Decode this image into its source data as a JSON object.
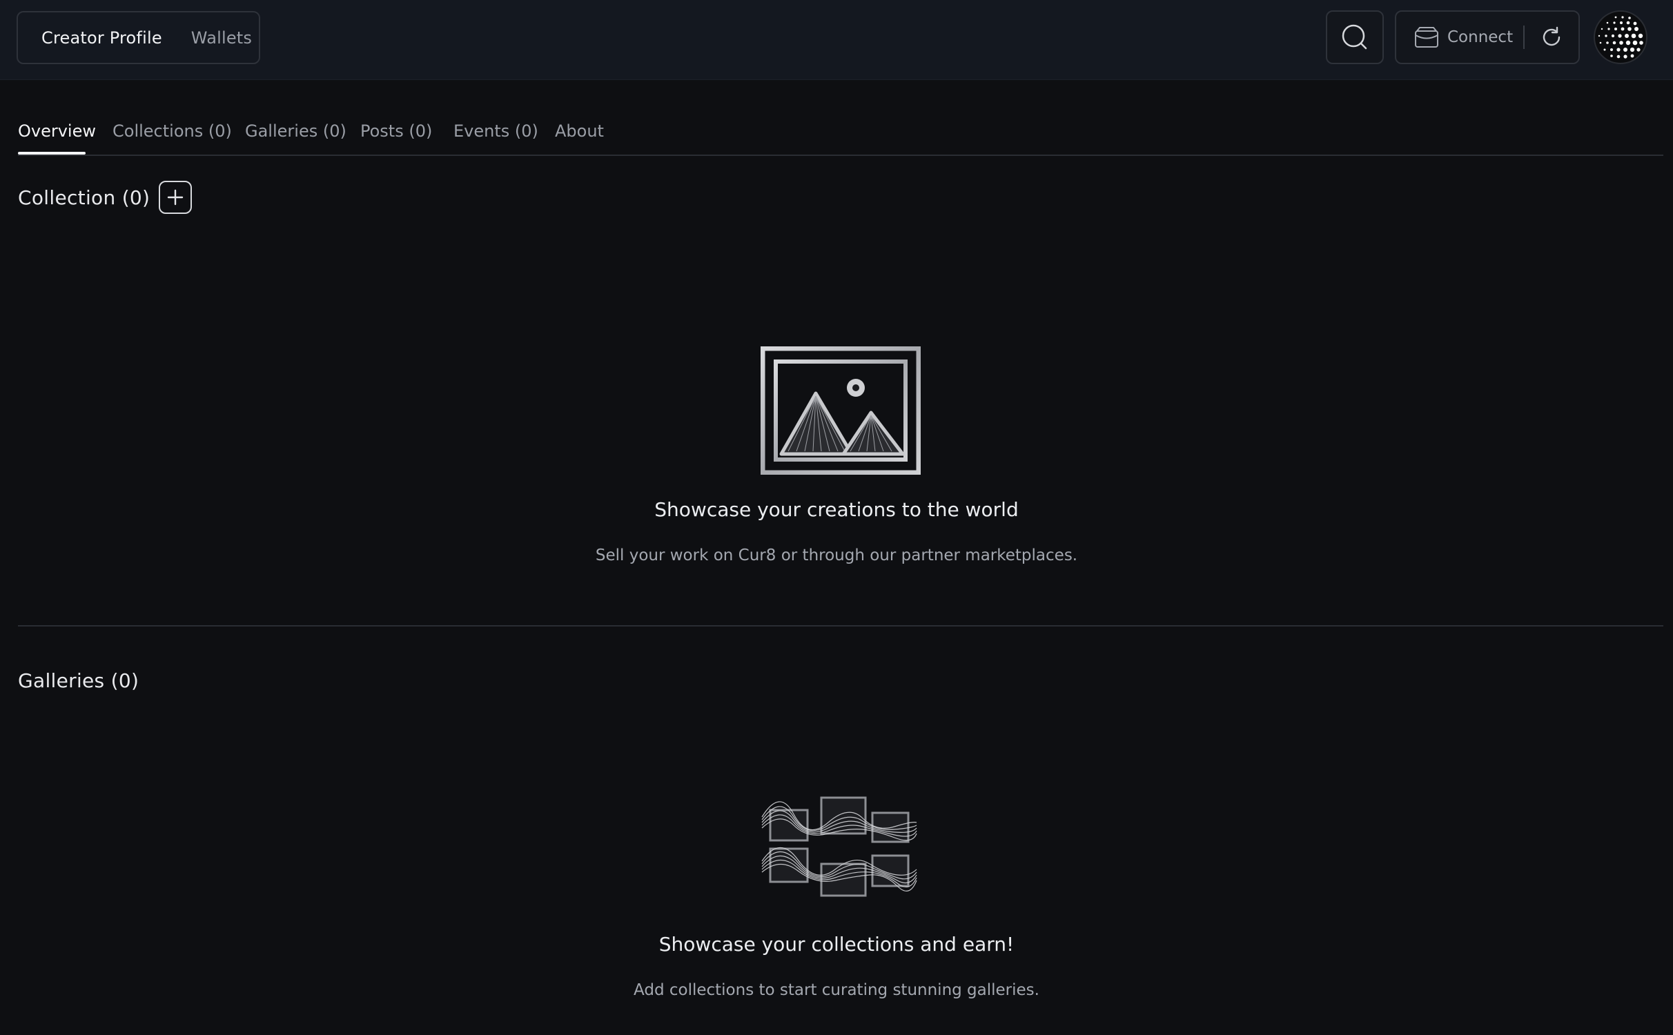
{
  "header": {
    "segments": [
      {
        "label": "Creator Profile",
        "active": true
      },
      {
        "label": "Wallets",
        "active": false
      }
    ],
    "search_icon": "search-icon",
    "connect_label": "Connect",
    "wallet_icon": "wallet-icon",
    "refresh_icon": "refresh-icon",
    "avatar_icon": "dotted-avatar"
  },
  "tabs": [
    {
      "label": "Overview",
      "active": true
    },
    {
      "label": "Collections (0)",
      "active": false
    },
    {
      "label": "Galleries (0)",
      "active": false
    },
    {
      "label": "Posts (0)",
      "active": false
    },
    {
      "label": "Events (0)",
      "active": false
    },
    {
      "label": "About",
      "active": false
    }
  ],
  "collection_section": {
    "title": "Collection (0)",
    "add_icon": "plus-icon",
    "empty_title": "Showcase your creations to the world",
    "empty_subtitle": "Sell your work on Cur8 or through our partner marketplaces."
  },
  "galleries_section": {
    "title": "Galleries (0)",
    "empty_title": "Showcase your collections and earn!",
    "empty_subtitle": "Add collections to start curating stunning galleries."
  },
  "colors": {
    "background": "#0e0f12",
    "topbar": "#141820",
    "border": "#2e323a",
    "text_primary": "#f2f3f5",
    "text_muted": "#9a9ea6"
  }
}
